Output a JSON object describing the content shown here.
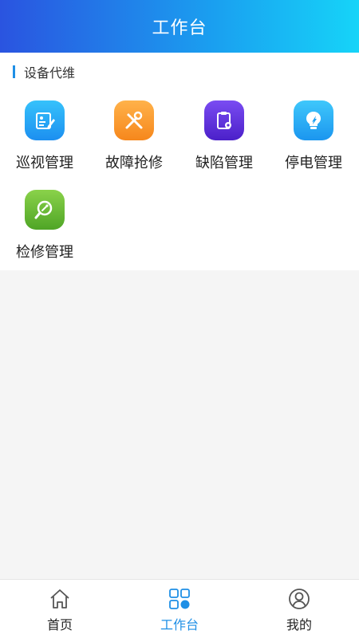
{
  "header": {
    "title": "工作台"
  },
  "section": {
    "title": "设备代维",
    "accent": "#1e8fe6",
    "items": [
      {
        "label": "巡视管理",
        "icon": "inspection-icon",
        "color_top": "#36c2fb",
        "color_bottom": "#1c8ff0"
      },
      {
        "label": "故障抢修",
        "icon": "repair-tools-icon",
        "color_top": "#ffb24a",
        "color_bottom": "#f6871c"
      },
      {
        "label": "缺陷管理",
        "icon": "defect-clipboard-icon",
        "color_top": "#7a4cf2",
        "color_bottom": "#4b20c9"
      },
      {
        "label": "停电管理",
        "icon": "power-bulb-icon",
        "color_top": "#3fc8fb",
        "color_bottom": "#1b96ef"
      },
      {
        "label": "检修管理",
        "icon": "maintenance-search-icon",
        "color_top": "#8ad24a",
        "color_bottom": "#4fa526"
      }
    ]
  },
  "tabbar": {
    "items": [
      {
        "label": "首页",
        "icon": "home-icon",
        "active": false
      },
      {
        "label": "工作台",
        "icon": "workbench-grid-icon",
        "active": true
      },
      {
        "label": "我的",
        "icon": "user-profile-icon",
        "active": false
      }
    ],
    "active_color": "#1e8fe6"
  }
}
